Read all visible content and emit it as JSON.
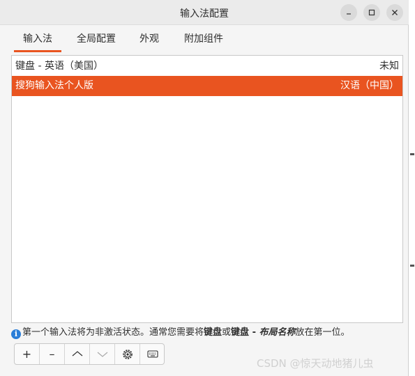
{
  "window": {
    "title": "输入法配置",
    "controls": {
      "minimize": "–",
      "maximize": "□",
      "close": "×"
    }
  },
  "tabs": [
    {
      "label": "输入法",
      "active": true
    },
    {
      "label": "全局配置",
      "active": false
    },
    {
      "label": "外观",
      "active": false
    },
    {
      "label": "附加组件",
      "active": false
    }
  ],
  "list": {
    "header": {
      "name": "键盘 - 英语（美国）",
      "lang": "未知"
    },
    "selected": {
      "name": "搜狗输入法个人版",
      "lang": "汉语（中国）"
    }
  },
  "hint": {
    "prefix": "第一个输入法将为非激活状态。通常您需要将",
    "bold1": "键盘",
    "mid": "或",
    "bold2": "键盘",
    "dash": " - ",
    "italic": "布局名称",
    "suffix": "放在第一位。"
  },
  "toolbar": {
    "add": "+",
    "remove": "–",
    "icons": [
      "up-icon",
      "down-icon",
      "configure-icon",
      "keyboard-icon"
    ]
  },
  "colors": {
    "accent": "#e95420",
    "info": "#2a7ed8"
  },
  "watermark": "CSDN @惊天动地猪儿虫"
}
